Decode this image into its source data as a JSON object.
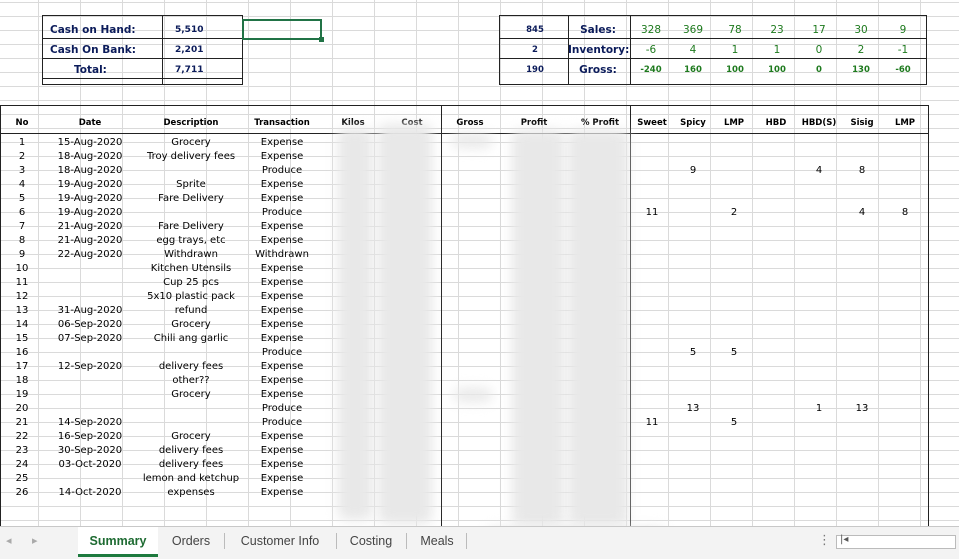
{
  "summary_left": {
    "rows": [
      {
        "label": "Cash on Hand:",
        "value": "5,510"
      },
      {
        "label": "Cash On Bank:",
        "value": "2,201"
      },
      {
        "label": "Total:",
        "value": "7,711"
      }
    ]
  },
  "summary_right": {
    "rows": [
      {
        "lead": "845",
        "label": "Sales:",
        "vals": [
          "328",
          "369",
          "78",
          "23",
          "17",
          "30",
          "9"
        ]
      },
      {
        "lead": "2",
        "label": "Inventory:",
        "vals": [
          "-6",
          "4",
          "1",
          "1",
          "0",
          "2",
          "-1"
        ]
      },
      {
        "lead": "190",
        "label": "Gross:",
        "vals": [
          "-240",
          "160",
          "100",
          "100",
          "0",
          "130",
          "-60"
        ]
      }
    ]
  },
  "headers": [
    "No",
    "Date",
    "Description",
    "Transaction",
    "Kilos",
    "Cost",
    "Gross",
    "Profit",
    "% Profit",
    "Sweet",
    "Spicy",
    "LMP",
    "HBD",
    "HBD(S)",
    "Sisig",
    "LMP"
  ],
  "rows": [
    {
      "no": "1",
      "date": "15-Aug-2020",
      "desc": "Grocery",
      "trans": "Expense",
      "sweet": "",
      "spicy": "",
      "lmp": "",
      "hbd": "",
      "hbds": "",
      "sisig": "",
      "lmp2": ""
    },
    {
      "no": "2",
      "date": "18-Aug-2020",
      "desc": "Troy delivery fees",
      "trans": "Expense",
      "sweet": "",
      "spicy": "",
      "lmp": "",
      "hbd": "",
      "hbds": "",
      "sisig": "",
      "lmp2": ""
    },
    {
      "no": "3",
      "date": "18-Aug-2020",
      "desc": "",
      "trans": "Produce",
      "sweet": "",
      "spicy": "9",
      "lmp": "",
      "hbd": "",
      "hbds": "4",
      "sisig": "8",
      "lmp2": ""
    },
    {
      "no": "4",
      "date": "19-Aug-2020",
      "desc": "Sprite",
      "trans": "Expense",
      "sweet": "",
      "spicy": "",
      "lmp": "",
      "hbd": "",
      "hbds": "",
      "sisig": "",
      "lmp2": ""
    },
    {
      "no": "5",
      "date": "19-Aug-2020",
      "desc": "Fare Delivery",
      "trans": "Expense",
      "sweet": "",
      "spicy": "",
      "lmp": "",
      "hbd": "",
      "hbds": "",
      "sisig": "",
      "lmp2": ""
    },
    {
      "no": "6",
      "date": "19-Aug-2020",
      "desc": "",
      "trans": "Produce",
      "sweet": "11",
      "spicy": "",
      "lmp": "2",
      "hbd": "",
      "hbds": "",
      "sisig": "4",
      "lmp2": "8"
    },
    {
      "no": "7",
      "date": "21-Aug-2020",
      "desc": "Fare Delivery",
      "trans": "Expense",
      "sweet": "",
      "spicy": "",
      "lmp": "",
      "hbd": "",
      "hbds": "",
      "sisig": "",
      "lmp2": ""
    },
    {
      "no": "8",
      "date": "21-Aug-2020",
      "desc": "egg trays, etc",
      "trans": "Expense",
      "sweet": "",
      "spicy": "",
      "lmp": "",
      "hbd": "",
      "hbds": "",
      "sisig": "",
      "lmp2": ""
    },
    {
      "no": "9",
      "date": "22-Aug-2020",
      "desc": "Withdrawn",
      "trans": "Withdrawn",
      "sweet": "",
      "spicy": "",
      "lmp": "",
      "hbd": "",
      "hbds": "",
      "sisig": "",
      "lmp2": ""
    },
    {
      "no": "10",
      "date": "",
      "desc": "Kitchen Utensils",
      "trans": "Expense",
      "sweet": "",
      "spicy": "",
      "lmp": "",
      "hbd": "",
      "hbds": "",
      "sisig": "",
      "lmp2": ""
    },
    {
      "no": "11",
      "date": "",
      "desc": "Cup 25 pcs",
      "trans": "Expense",
      "sweet": "",
      "spicy": "",
      "lmp": "",
      "hbd": "",
      "hbds": "",
      "sisig": "",
      "lmp2": ""
    },
    {
      "no": "12",
      "date": "",
      "desc": "5x10 plastic pack",
      "trans": "Expense",
      "sweet": "",
      "spicy": "",
      "lmp": "",
      "hbd": "",
      "hbds": "",
      "sisig": "",
      "lmp2": ""
    },
    {
      "no": "13",
      "date": "31-Aug-2020",
      "desc": "refund",
      "trans": "Expense",
      "sweet": "",
      "spicy": "",
      "lmp": "",
      "hbd": "",
      "hbds": "",
      "sisig": "",
      "lmp2": ""
    },
    {
      "no": "14",
      "date": "06-Sep-2020",
      "desc": "Grocery",
      "trans": "Expense",
      "sweet": "",
      "spicy": "",
      "lmp": "",
      "hbd": "",
      "hbds": "",
      "sisig": "",
      "lmp2": ""
    },
    {
      "no": "15",
      "date": "07-Sep-2020",
      "desc": "Chili ang garlic",
      "trans": "Expense",
      "sweet": "",
      "spicy": "",
      "lmp": "",
      "hbd": "",
      "hbds": "",
      "sisig": "",
      "lmp2": ""
    },
    {
      "no": "16",
      "date": "",
      "desc": "",
      "trans": "Produce",
      "sweet": "",
      "spicy": "5",
      "lmp": "5",
      "hbd": "",
      "hbds": "",
      "sisig": "",
      "lmp2": ""
    },
    {
      "no": "17",
      "date": "12-Sep-2020",
      "desc": "delivery fees",
      "trans": "Expense",
      "sweet": "",
      "spicy": "",
      "lmp": "",
      "hbd": "",
      "hbds": "",
      "sisig": "",
      "lmp2": ""
    },
    {
      "no": "18",
      "date": "",
      "desc": "other??",
      "trans": "Expense",
      "sweet": "",
      "spicy": "",
      "lmp": "",
      "hbd": "",
      "hbds": "",
      "sisig": "",
      "lmp2": ""
    },
    {
      "no": "19",
      "date": "",
      "desc": "Grocery",
      "trans": "Expense",
      "sweet": "",
      "spicy": "",
      "lmp": "",
      "hbd": "",
      "hbds": "",
      "sisig": "",
      "lmp2": ""
    },
    {
      "no": "20",
      "date": "",
      "desc": "",
      "trans": "Produce",
      "sweet": "",
      "spicy": "13",
      "lmp": "",
      "hbd": "",
      "hbds": "1",
      "sisig": "13",
      "lmp2": ""
    },
    {
      "no": "21",
      "date": "14-Sep-2020",
      "desc": "",
      "trans": "Produce",
      "sweet": "11",
      "spicy": "",
      "lmp": "5",
      "hbd": "",
      "hbds": "",
      "sisig": "",
      "lmp2": ""
    },
    {
      "no": "22",
      "date": "16-Sep-2020",
      "desc": "Grocery",
      "trans": "Expense",
      "sweet": "",
      "spicy": "",
      "lmp": "",
      "hbd": "",
      "hbds": "",
      "sisig": "",
      "lmp2": ""
    },
    {
      "no": "23",
      "date": "30-Sep-2020",
      "desc": "delivery fees",
      "trans": "Expense",
      "sweet": "",
      "spicy": "",
      "lmp": "",
      "hbd": "",
      "hbds": "",
      "sisig": "",
      "lmp2": ""
    },
    {
      "no": "24",
      "date": "03-Oct-2020",
      "desc": "delivery fees",
      "trans": "Expense",
      "sweet": "",
      "spicy": "",
      "lmp": "",
      "hbd": "",
      "hbds": "",
      "sisig": "",
      "lmp2": ""
    },
    {
      "no": "25",
      "date": "",
      "desc": "lemon and ketchup",
      "trans": "Expense",
      "sweet": "",
      "spicy": "",
      "lmp": "",
      "hbd": "",
      "hbds": "",
      "sisig": "",
      "lmp2": ""
    },
    {
      "no": "26",
      "date": "14-Oct-2020",
      "desc": "expenses",
      "trans": "Expense",
      "sweet": "",
      "spicy": "",
      "lmp": "",
      "hbd": "",
      "hbds": "",
      "sisig": "",
      "lmp2": ""
    }
  ],
  "sheet_tabs": [
    "Summary",
    "Orders",
    "Customer Info",
    "Costing",
    "Meals"
  ],
  "active_tab": "Summary",
  "nav": {
    "prev": "◂",
    "next": "▸",
    "add": "⊕",
    "more": "⋮"
  },
  "colors": {
    "navy": "#0b1b5a",
    "green": "#1e7a1e",
    "tab_accent": "#1e7a3e",
    "selection": "#217346"
  }
}
